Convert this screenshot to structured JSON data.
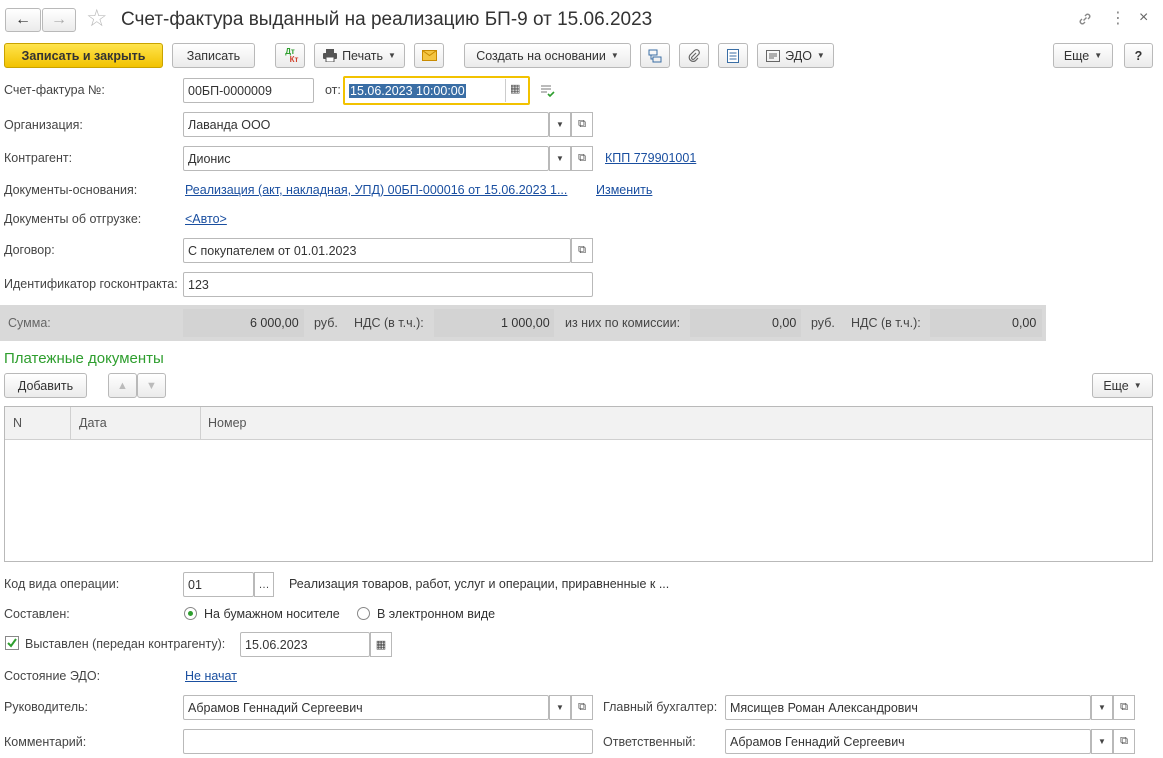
{
  "header": {
    "title": "Счет-фактура выданный на реализацию БП-9 от 15.06.2023",
    "back_icon": "←",
    "forward_icon": "→",
    "star_icon": "☆"
  },
  "toolbar": {
    "save_close": "Записать и закрыть",
    "save": "Записать",
    "print": "Печать",
    "create_based": "Создать на основании",
    "edo": "ЭДО",
    "more": "Еще",
    "help": "?",
    "dtkt_top": "Дт",
    "dtkt_bottom": "Кт"
  },
  "form": {
    "invoice_label": "Счет-фактура №:",
    "invoice_number": "00БП-0000009",
    "from_label": "от:",
    "invoice_date": "15.06.2023 10:00:00",
    "org_label": "Организация:",
    "org_value": "Лаванда ООО",
    "contractor_label": "Контрагент:",
    "contractor_value": "Дионис",
    "kpp_link": "КПП 779901001",
    "base_docs_label": "Документы-основания:",
    "base_docs_link": "Реализация (акт, накладная, УПД) 00БП-000016 от 15.06.2023 1...",
    "change_link": "Изменить",
    "shipping_docs_label": "Документы об отгрузке:",
    "shipping_docs_link": "<Авто>",
    "contract_label": "Договор:",
    "contract_value": "С покупателем от 01.01.2023",
    "gov_id_label": "Идентификатор госконтракта:",
    "gov_id_value": "123"
  },
  "sum_bar": {
    "sum_label": "Сумма:",
    "sum_value": "6 000,00",
    "currency1": "руб.",
    "vat_label1": "НДС (в т.ч.):",
    "vat_value1": "1 000,00",
    "commission_label": "из них по комиссии:",
    "commission_value": "0,00",
    "currency2": "руб.",
    "vat_label2": "НДС (в т.ч.):",
    "vat_value2": "0,00"
  },
  "payments": {
    "title": "Платежные документы",
    "add_button": "Добавить",
    "more": "Еще",
    "columns": [
      "N",
      "Дата",
      "Номер"
    ]
  },
  "bottom": {
    "op_code_label": "Код вида операции:",
    "op_code_value": "01",
    "op_code_desc": "Реализация товаров, работ, услуг и операции, приравненные к ...",
    "composed_label": "Составлен:",
    "paper_option": "На бумажном носителе",
    "electronic_option": "В электронном виде",
    "issued_label": "Выставлен (передан контрагенту):",
    "issued_date": "15.06.2023",
    "edo_status_label": "Состояние ЭДО:",
    "edo_status_link": "Не начат",
    "head_label": "Руководитель:",
    "head_value": "Абрамов Геннадий Сергеевич",
    "chief_acc_label": "Главный бухгалтер:",
    "chief_acc_value": "Мясищев Роман Александрович",
    "comment_label": "Комментарий:",
    "comment_value": "",
    "responsible_label": "Ответственный:",
    "responsible_value": "Абрамов Геннадий Сергеевич"
  },
  "colors": {
    "accent_yellow": "#f2c200",
    "link_blue": "#1a4fa0",
    "section_green": "#2e9e2e",
    "sum_bar_bg": "#d9d9d9"
  }
}
